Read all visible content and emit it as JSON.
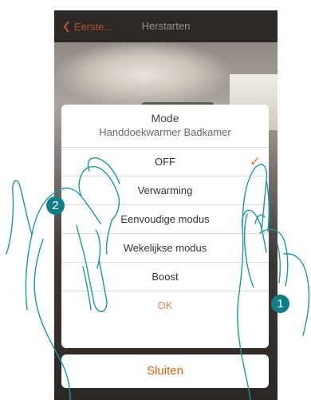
{
  "statusbar": {
    "back_label": "Eerste...",
    "title": "Herstarten"
  },
  "dialog": {
    "title": "Mode",
    "subtitle": "Handdoekwarmer Badkamer",
    "options": [
      {
        "label": "OFF",
        "selected": true
      },
      {
        "label": "Verwarming",
        "selected": false
      },
      {
        "label": "Eenvoudige modus",
        "selected": false
      },
      {
        "label": "Wekelijkse modus",
        "selected": false
      },
      {
        "label": "Boost",
        "selected": false
      }
    ],
    "ok_label": "OK",
    "check_icon": "checkmark-icon"
  },
  "close_label": "Sluiten",
  "steps": {
    "one": "1",
    "two": "2"
  },
  "colors": {
    "accent": "#e0600c",
    "step_badge": "#0e7f86",
    "hand_outline": "#1a9aa0"
  }
}
